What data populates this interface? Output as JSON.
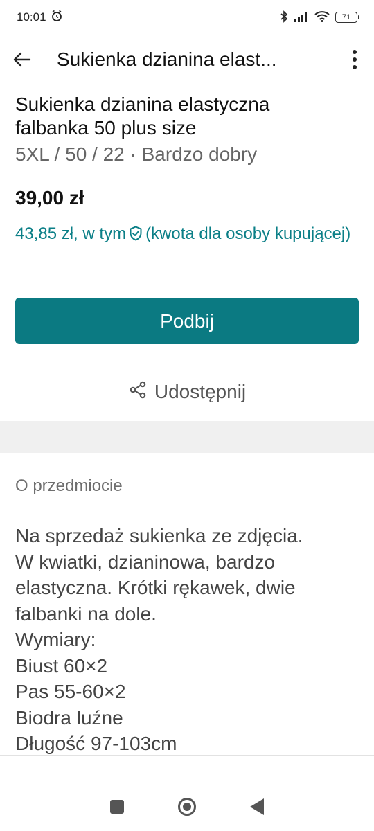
{
  "status_bar": {
    "time": "10:01",
    "battery": "71",
    "icons": [
      "alarm-icon",
      "bluetooth-icon",
      "signal-icon",
      "wifi-icon",
      "battery-icon"
    ]
  },
  "app_bar": {
    "title": "Sukienka dzianina elast..."
  },
  "item": {
    "title_line1": "Sukienka dzianina elastyczna",
    "title_line2": "falbanka 50 plus size",
    "subtitle": "5XL / 50 / 22 · Bardzo dobry",
    "price": "39,00 zł",
    "price_total": "43,85 zł, w tym",
    "buyer_protection": "(kwota dla osoby kupującej)"
  },
  "actions": {
    "bump_label": "Podbij",
    "share_label": "Udostępnij"
  },
  "about": {
    "label": "O przedmiocie",
    "description_lines": [
      "Na sprzedaż sukienka ze zdjęcia.",
      "W kwiatki, dzianinowa, bardzo",
      "elastyczna. Krótki rękawek, dwie",
      "falbanki na dole.",
      "Wymiary:",
      "Biust 60×2",
      "Pas 55-60×2",
      "Biodra luźne",
      "Długość 97-103cm"
    ]
  },
  "colors": {
    "accent": "#0b7a82",
    "accent_text": "#0b7f87"
  }
}
